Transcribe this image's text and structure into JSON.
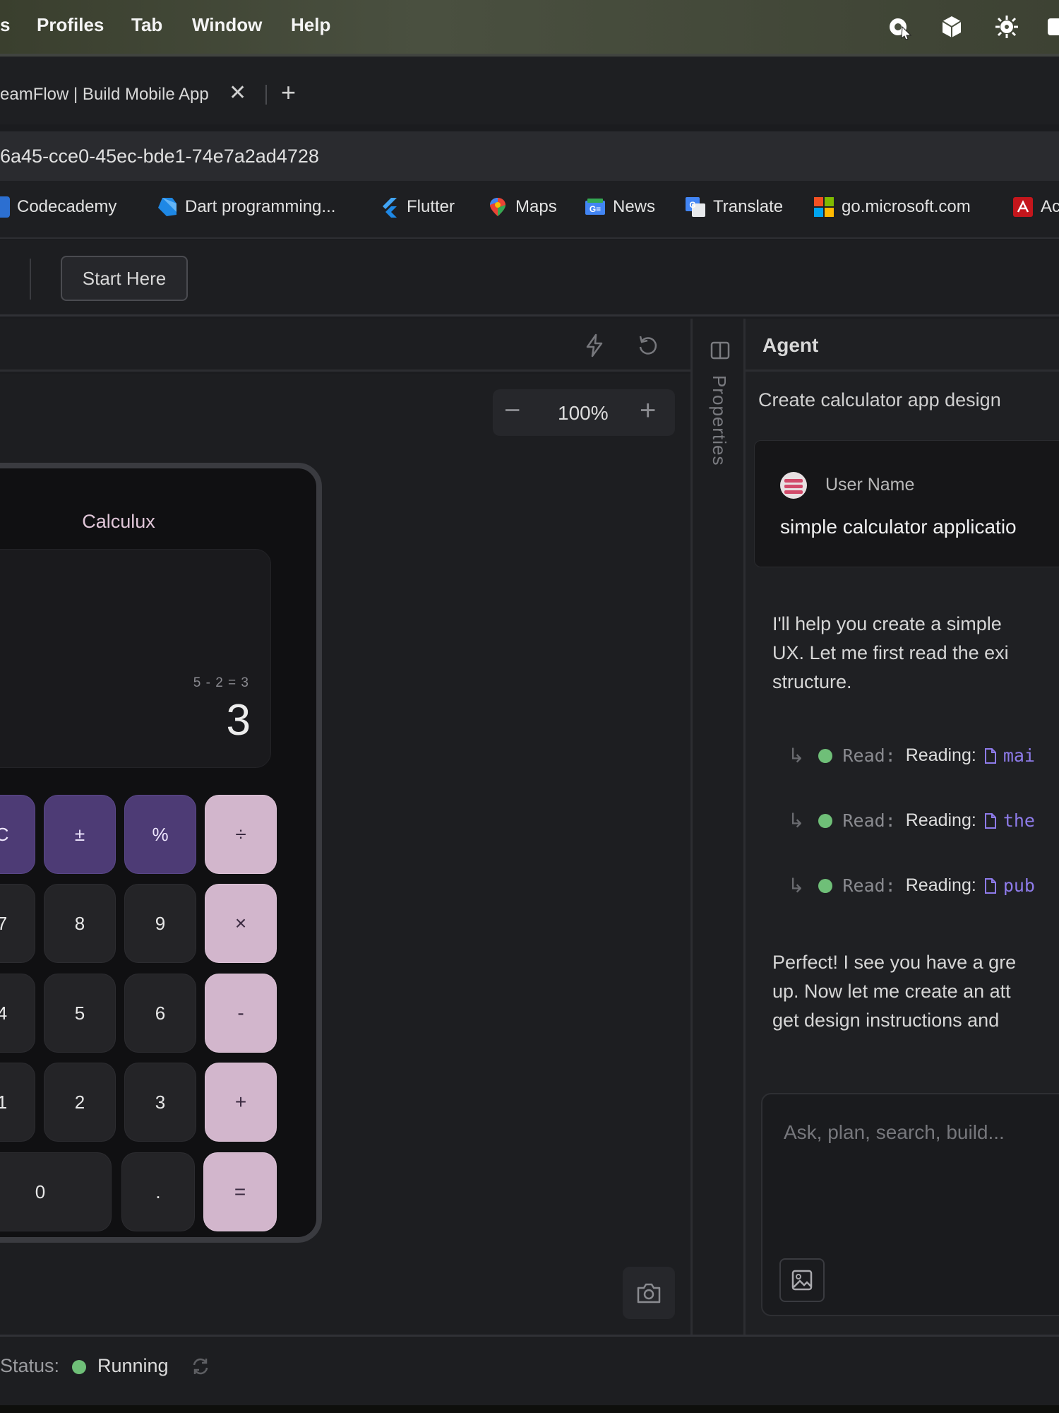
{
  "menubar": {
    "items": [
      "s",
      "Profiles",
      "Tab",
      "Window",
      "Help"
    ]
  },
  "tab": {
    "title": "eamFlow | Build Mobile App",
    "close": "✕",
    "new": "+"
  },
  "address": {
    "url": "6a45-cce0-45ec-bde1-74e7a2ad4728"
  },
  "bookmarks": [
    "Codecademy",
    "Dart programming...",
    "Flutter",
    "Maps",
    "News",
    "Translate",
    "go.microsoft.com",
    "Ac"
  ],
  "toolbar": {
    "start_label": "Start Here"
  },
  "canvas": {
    "zoom_minus": "−",
    "zoom_value": "100%",
    "zoom_plus": "+"
  },
  "calculator": {
    "title": "Calculux",
    "expression": "5 - 2 = 3",
    "result": "3",
    "keys": {
      "c": "C",
      "plusminus": "±",
      "percent": "%",
      "divide": "÷",
      "k7": "7",
      "k8": "8",
      "k9": "9",
      "multiply": "×",
      "k4": "4",
      "k5": "5",
      "k6": "6",
      "minus": "-",
      "k1": "1",
      "k2": "2",
      "k3": "3",
      "plus": "+",
      "k0": "0",
      "dot": ".",
      "equals": "="
    }
  },
  "rail": {
    "label": "Properties"
  },
  "agent": {
    "title": "Agent",
    "task": "Create calculator app design",
    "user_name": "User Name",
    "user_message": "simple calculator applicatio",
    "para1": [
      "I'll help you create a simple",
      "UX. Let me first read the exi",
      "structure."
    ],
    "reads": [
      {
        "label": "Read:",
        "text": "Reading:",
        "file": "mai"
      },
      {
        "label": "Read:",
        "text": "Reading:",
        "file": "the"
      },
      {
        "label": "Read:",
        "text": "Reading:",
        "file": "pub"
      }
    ],
    "para2": [
      "Perfect! I see you have a gre",
      "up. Now let me create an att",
      "get design instructions and"
    ],
    "composer_placeholder": "Ask, plan, search, build..."
  },
  "status": {
    "label": "Status:",
    "value": "Running"
  },
  "colors": {
    "fn_key": "#4d3b75",
    "op_key": "#d2b6cc",
    "running": "#6fbf78",
    "file_link": "#8e7bea"
  }
}
